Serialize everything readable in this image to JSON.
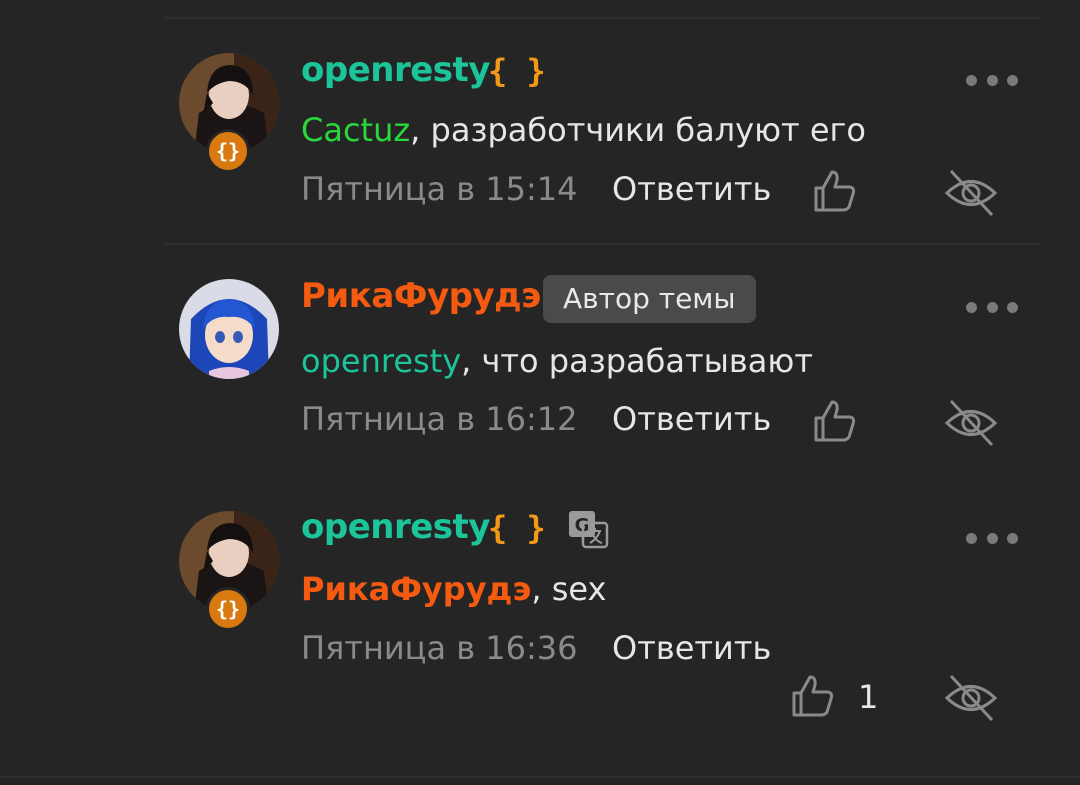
{
  "comments": [
    {
      "username": "openresty",
      "username_color": "#1cc49a",
      "role_icon": "{ }",
      "badge_icon": "{}",
      "mention": "Cactuz",
      "mention_color": "#28d83a",
      "text": ", разработчики балуют его",
      "time": "Пятница в 15:14",
      "reply_label": "Ответить"
    },
    {
      "username": "РикаФурудэ",
      "username_color": "#f45b10",
      "author_tag": "Автор темы",
      "mention": "openresty",
      "mention_color": "#1cc49a",
      "text": ", что разрабатывают",
      "time": "Пятница в 16:12",
      "reply_label": "Ответить"
    },
    {
      "username": "openresty",
      "username_color": "#1cc49a",
      "role_icon": "{ }",
      "badge_icon": "{}",
      "mention": "РикаФурудэ",
      "mention_color": "#f45b10",
      "text": ", sex",
      "time": "Пятница в 16:36",
      "reply_label": "Ответить",
      "like_count": "1"
    }
  ],
  "icons": {
    "more": "more-horizontal-icon",
    "like": "thumbs-up-icon",
    "hide": "eye-off-icon",
    "translate": "translate-icon"
  }
}
